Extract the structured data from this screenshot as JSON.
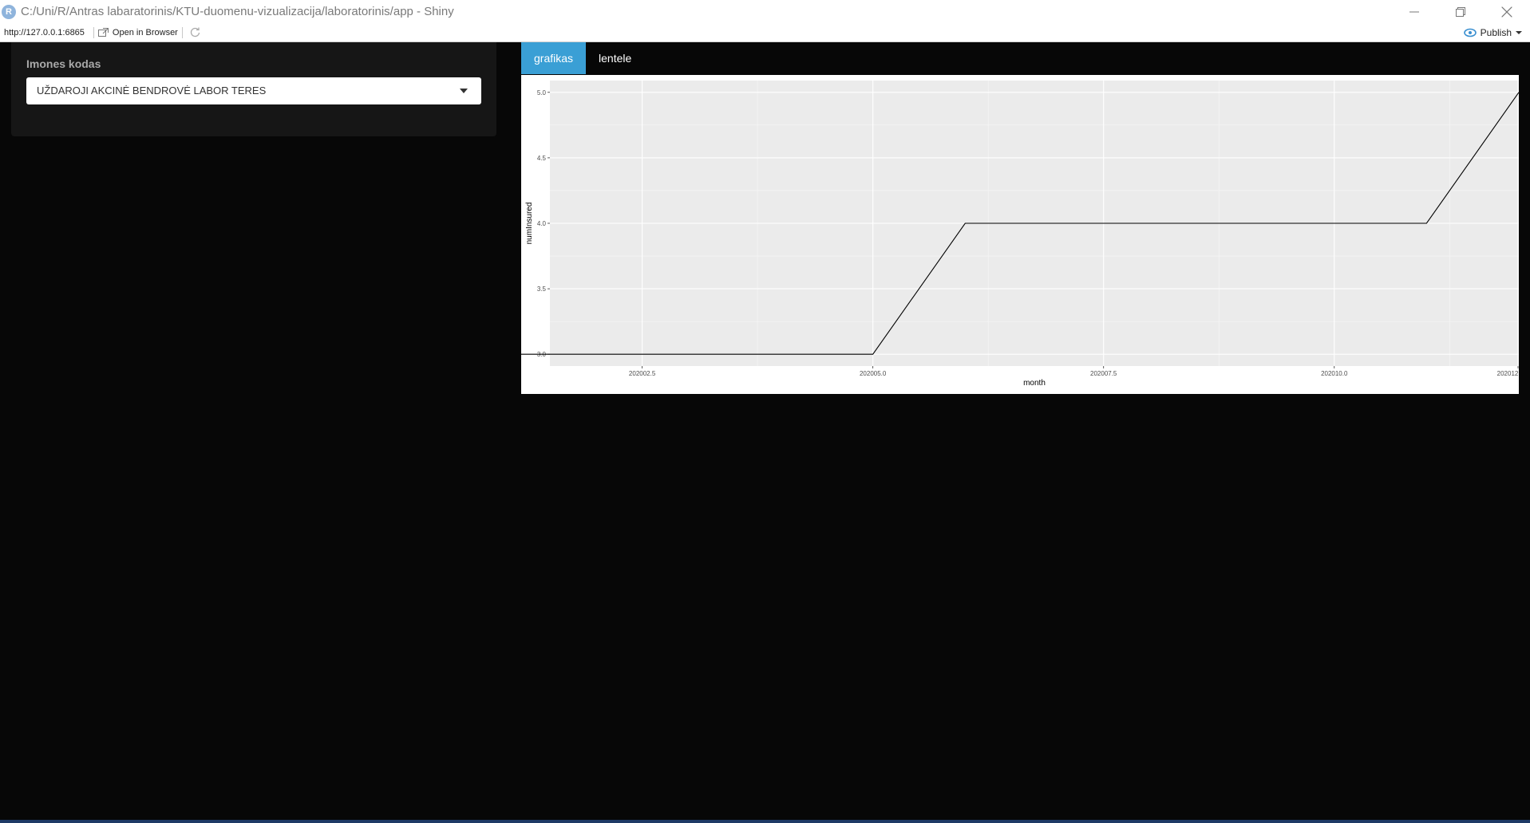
{
  "window": {
    "title": "C:/Uni/R/Antras labaratorinis/KTU-duomenu-vizualizacija/laboratorinis/app - Shiny",
    "logo_letter": "R"
  },
  "toolbar": {
    "url": "http://127.0.0.1:6865",
    "open_in_browser": "Open in Browser",
    "publish": "Publish"
  },
  "sidebar": {
    "label": "Imones kodas",
    "select_value": "UŽDAROJI AKCINĖ BENDROVĖ LABOR TERES"
  },
  "tabs": [
    {
      "label": "grafikas",
      "active": true
    },
    {
      "label": "lentele",
      "active": false
    }
  ],
  "colors": {
    "accent": "#3a9fd5",
    "panel_bg": "#ebebeb",
    "line": "#000000"
  },
  "chart_data": {
    "type": "line",
    "xlabel": "month",
    "ylabel": "numInsured",
    "xlim": [
      202001.5,
      202012.0
    ],
    "ylim": [
      2.91,
      5.09
    ],
    "x_ticks": [
      202002.5,
      202005.0,
      202007.5,
      202010.0,
      202012.5
    ],
    "x_tick_labels": [
      "202002.5",
      "202005.0",
      "202007.5",
      "202010.0",
      "202012"
    ],
    "y_ticks": [
      3.0,
      3.5,
      4.0,
      4.5,
      5.0
    ],
    "y_tick_labels": [
      "3.0",
      "3.5",
      "4.0",
      "4.5",
      "5.0"
    ],
    "grid": true,
    "series": [
      {
        "x": [
          202001,
          202002,
          202003,
          202004,
          202005,
          202006,
          202007,
          202008,
          202009,
          202010,
          202011,
          202012
        ],
        "y": [
          3,
          3,
          3,
          3,
          3,
          4,
          4,
          4,
          4,
          4,
          4,
          5
        ]
      }
    ]
  }
}
